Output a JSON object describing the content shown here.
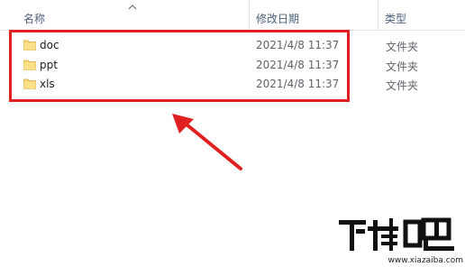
{
  "header": {
    "name_label": "名称",
    "date_label": "修改日期",
    "type_label": "类型"
  },
  "files": [
    {
      "name": "doc",
      "modified": "2021/4/8 11:37",
      "type": "文件夹",
      "icon": "folder-icon"
    },
    {
      "name": "ppt",
      "modified": "2021/4/8 11:37",
      "type": "文件夹",
      "icon": "folder-icon"
    },
    {
      "name": "xls",
      "modified": "2021/4/8 11:37",
      "type": "文件夹",
      "icon": "folder-icon"
    }
  ],
  "annotation": {
    "box_color": "#e02020",
    "arrow_color": "#e02020"
  },
  "watermark": {
    "brand": "下载吧",
    "url": "www.xiazaiba.com"
  }
}
